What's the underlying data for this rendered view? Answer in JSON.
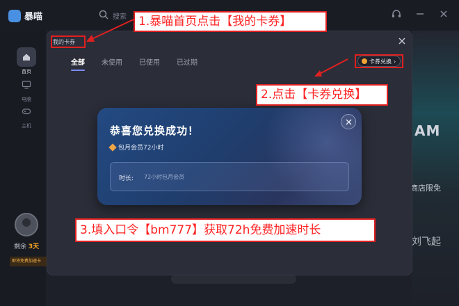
{
  "app": {
    "name": "暴喵",
    "search_placeholder": "搜索"
  },
  "sidebar": {
    "items": [
      {
        "label": "首页",
        "icon": "home-icon",
        "active": true
      },
      {
        "label": "电脑",
        "icon": "monitor-icon",
        "active": false
      },
      {
        "label": "主机",
        "icon": "gamepad-icon",
        "active": false
      }
    ],
    "remain_prefix": "剩余",
    "remain_value": "3天",
    "promo": "即将免费加速卡"
  },
  "background": {
    "text_am": "AM",
    "text_shop": "商店限免",
    "text_fly": "刘飞起"
  },
  "modal": {
    "title": "我的卡券",
    "tabs": [
      "全部",
      "未使用",
      "已使用",
      "已过期"
    ],
    "active_tab": 0,
    "redeem_button": "卡券兑换",
    "card": {
      "title": "恭喜您兑换成功！",
      "subtitle": "包月会员72小时",
      "field_label": "时长:",
      "field_value": "72小时包月会员"
    }
  },
  "annotations": {
    "step1": "1.暴喵首页点击【我的卡券】",
    "step2": "2.点击【卡券兑换】",
    "step3": "3.填入口令【bm777】获取72h免费加速时长"
  },
  "colors": {
    "annotation": "#e02020",
    "accent": "#7b8bff",
    "gold": "#f3a645"
  }
}
